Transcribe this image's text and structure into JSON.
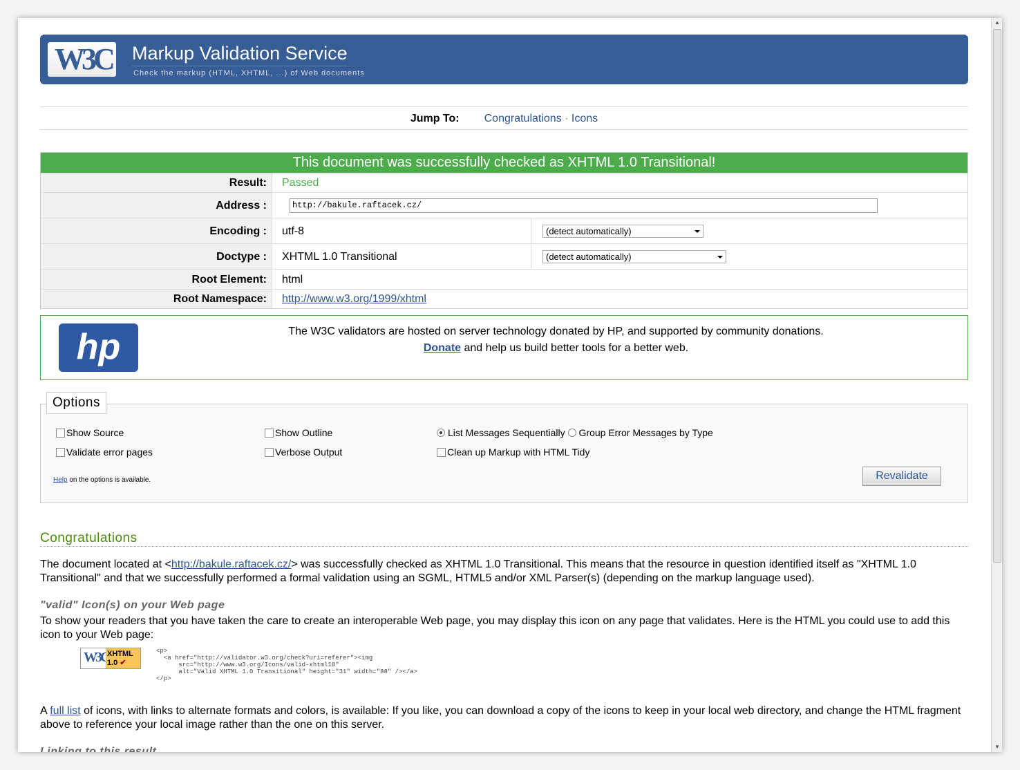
{
  "header": {
    "title": "Markup Validation Service",
    "subtitle": "Check the markup (HTML, XHTML, ...) of Web documents",
    "logo": "W3C"
  },
  "jump": {
    "label": "Jump To:",
    "links": [
      "Congratulations",
      "Icons"
    ],
    "sep": " · "
  },
  "result": {
    "heading": "This document was successfully checked as XHTML 1.0 Transitional!",
    "rows": [
      {
        "label": "Result:",
        "value": "Passed"
      },
      {
        "label": "Address :",
        "value": "http://bakule.raftacek.cz/"
      },
      {
        "label": "Encoding :",
        "value": "utf-8",
        "select": "(detect automatically)"
      },
      {
        "label": "Doctype :",
        "value": "XHTML 1.0 Transitional",
        "select": "(detect automatically)"
      },
      {
        "label": "Root Element:",
        "value": "html"
      },
      {
        "label": "Root Namespace:",
        "value": "http://www.w3.org/1999/xhtml"
      }
    ],
    "passed_color": "#4cac4c"
  },
  "sponsor": {
    "logo": "hp",
    "line1": "The W3C validators are hosted on server technology donated by HP, and supported by community donations.",
    "donate": "Donate",
    "line2": " and help us build better tools for a better web."
  },
  "options": {
    "legend": "Options",
    "show_source": "Show Source",
    "validate_error": "Validate error pages",
    "show_outline": "Show Outline",
    "verbose": "Verbose Output",
    "list_seq": "List Messages Sequentially",
    "group": "Group Error Messages by Type",
    "tidy": "Clean up Markup with HTML Tidy",
    "help": "Help",
    "help_rest": " on the options is available.",
    "revalidate": "Revalidate"
  },
  "congrats": {
    "title": "Congratulations",
    "p1a": "The document located at <",
    "url": "http://bakule.raftacek.cz/",
    "p1b": "> was successfully checked as XHTML 1.0 Transitional. This means that the resource in question identified itself as \"XHTML 1.0 Transitional\" and that we successfully performed a formal validation using an SGML, HTML5 and/or XML Parser(s) (depending on the markup language used).",
    "icons_title": "\"valid\" Icon(s) on your Web page",
    "icons_p": "To show your readers that you have taken the care to create an interoperable Web page, you may display this icon on any page that validates. Here is the HTML you could use to add this icon to your Web page:",
    "badge_w3c": "W3C",
    "badge_x": "XHTML",
    "badge_v": "1.0",
    "code": "<p>\n  <a href=\"http://validator.w3.org/check?uri=referer\"><img\n      src=\"http://www.w3.org/Icons/valid-xhtml10\"\n      alt=\"Valid XHTML 1.0 Transitional\" height=\"31\" width=\"88\" /></a>\n</p>",
    "full_a": "A ",
    "full_link": "full list",
    "full_b": " of icons, with links to alternate formats and colors, is available: If you like, you can download a copy of the icons to keep in your local web directory, and change the HTML fragment above to reference your local image rather than the one on this server.",
    "linking_title": "Linking to this result"
  }
}
